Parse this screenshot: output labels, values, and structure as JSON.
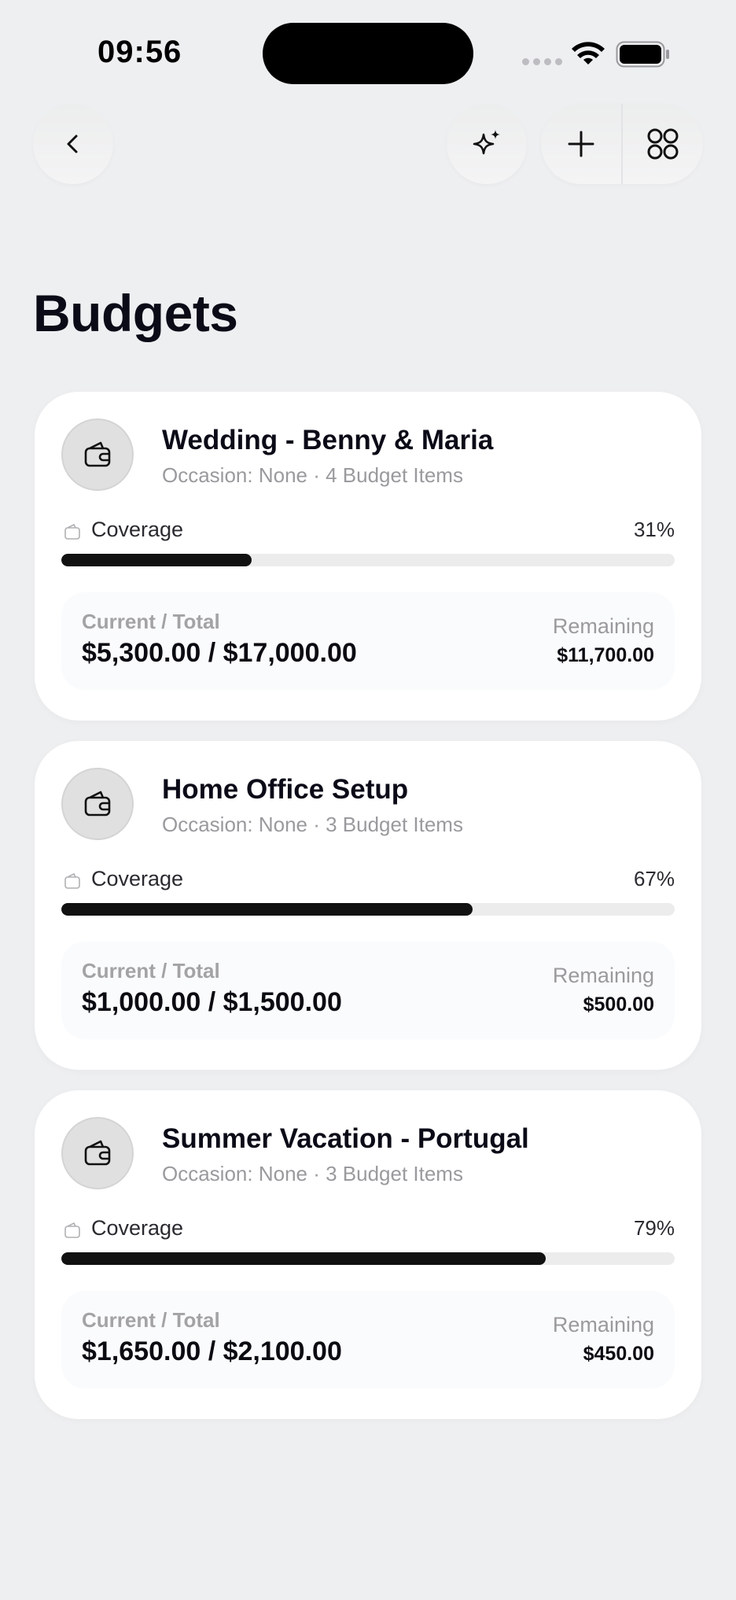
{
  "status_bar": {
    "time": "09:56"
  },
  "page": {
    "title": "Budgets"
  },
  "budgets": [
    {
      "title": "Wedding - Benny & Maria",
      "subtitle": "Occasion: None · 4 Budget Items",
      "coverage_label": "Coverage",
      "coverage_pct": "31%",
      "coverage_fraction": 0.31,
      "current_total_label": "Current / Total",
      "current_total": "$5,300.00 / $17,000.00",
      "remaining_label": "Remaining",
      "remaining": "$11,700.00"
    },
    {
      "title": "Home Office Setup",
      "subtitle": "Occasion: None · 3 Budget Items",
      "coverage_label": "Coverage",
      "coverage_pct": "67%",
      "coverage_fraction": 0.67,
      "current_total_label": "Current / Total",
      "current_total": "$1,000.00 / $1,500.00",
      "remaining_label": "Remaining",
      "remaining": "$500.00"
    },
    {
      "title": "Summer Vacation - Portugal",
      "subtitle": "Occasion: None · 3 Budget Items",
      "coverage_label": "Coverage",
      "coverage_pct": "79%",
      "coverage_fraction": 0.79,
      "current_total_label": "Current / Total",
      "current_total": "$1,650.00 / $2,100.00",
      "remaining_label": "Remaining",
      "remaining": "$450.00"
    }
  ],
  "icons": {
    "back": "chevron-left-icon",
    "sparkle": "sparkle-icon",
    "add": "plus-icon",
    "grid": "grid-icon",
    "wallet": "wallet-icon"
  },
  "colors": {
    "background": "#eeeff1",
    "card": "#ffffff",
    "progress_fill": "#111111",
    "progress_track": "#ececed"
  }
}
